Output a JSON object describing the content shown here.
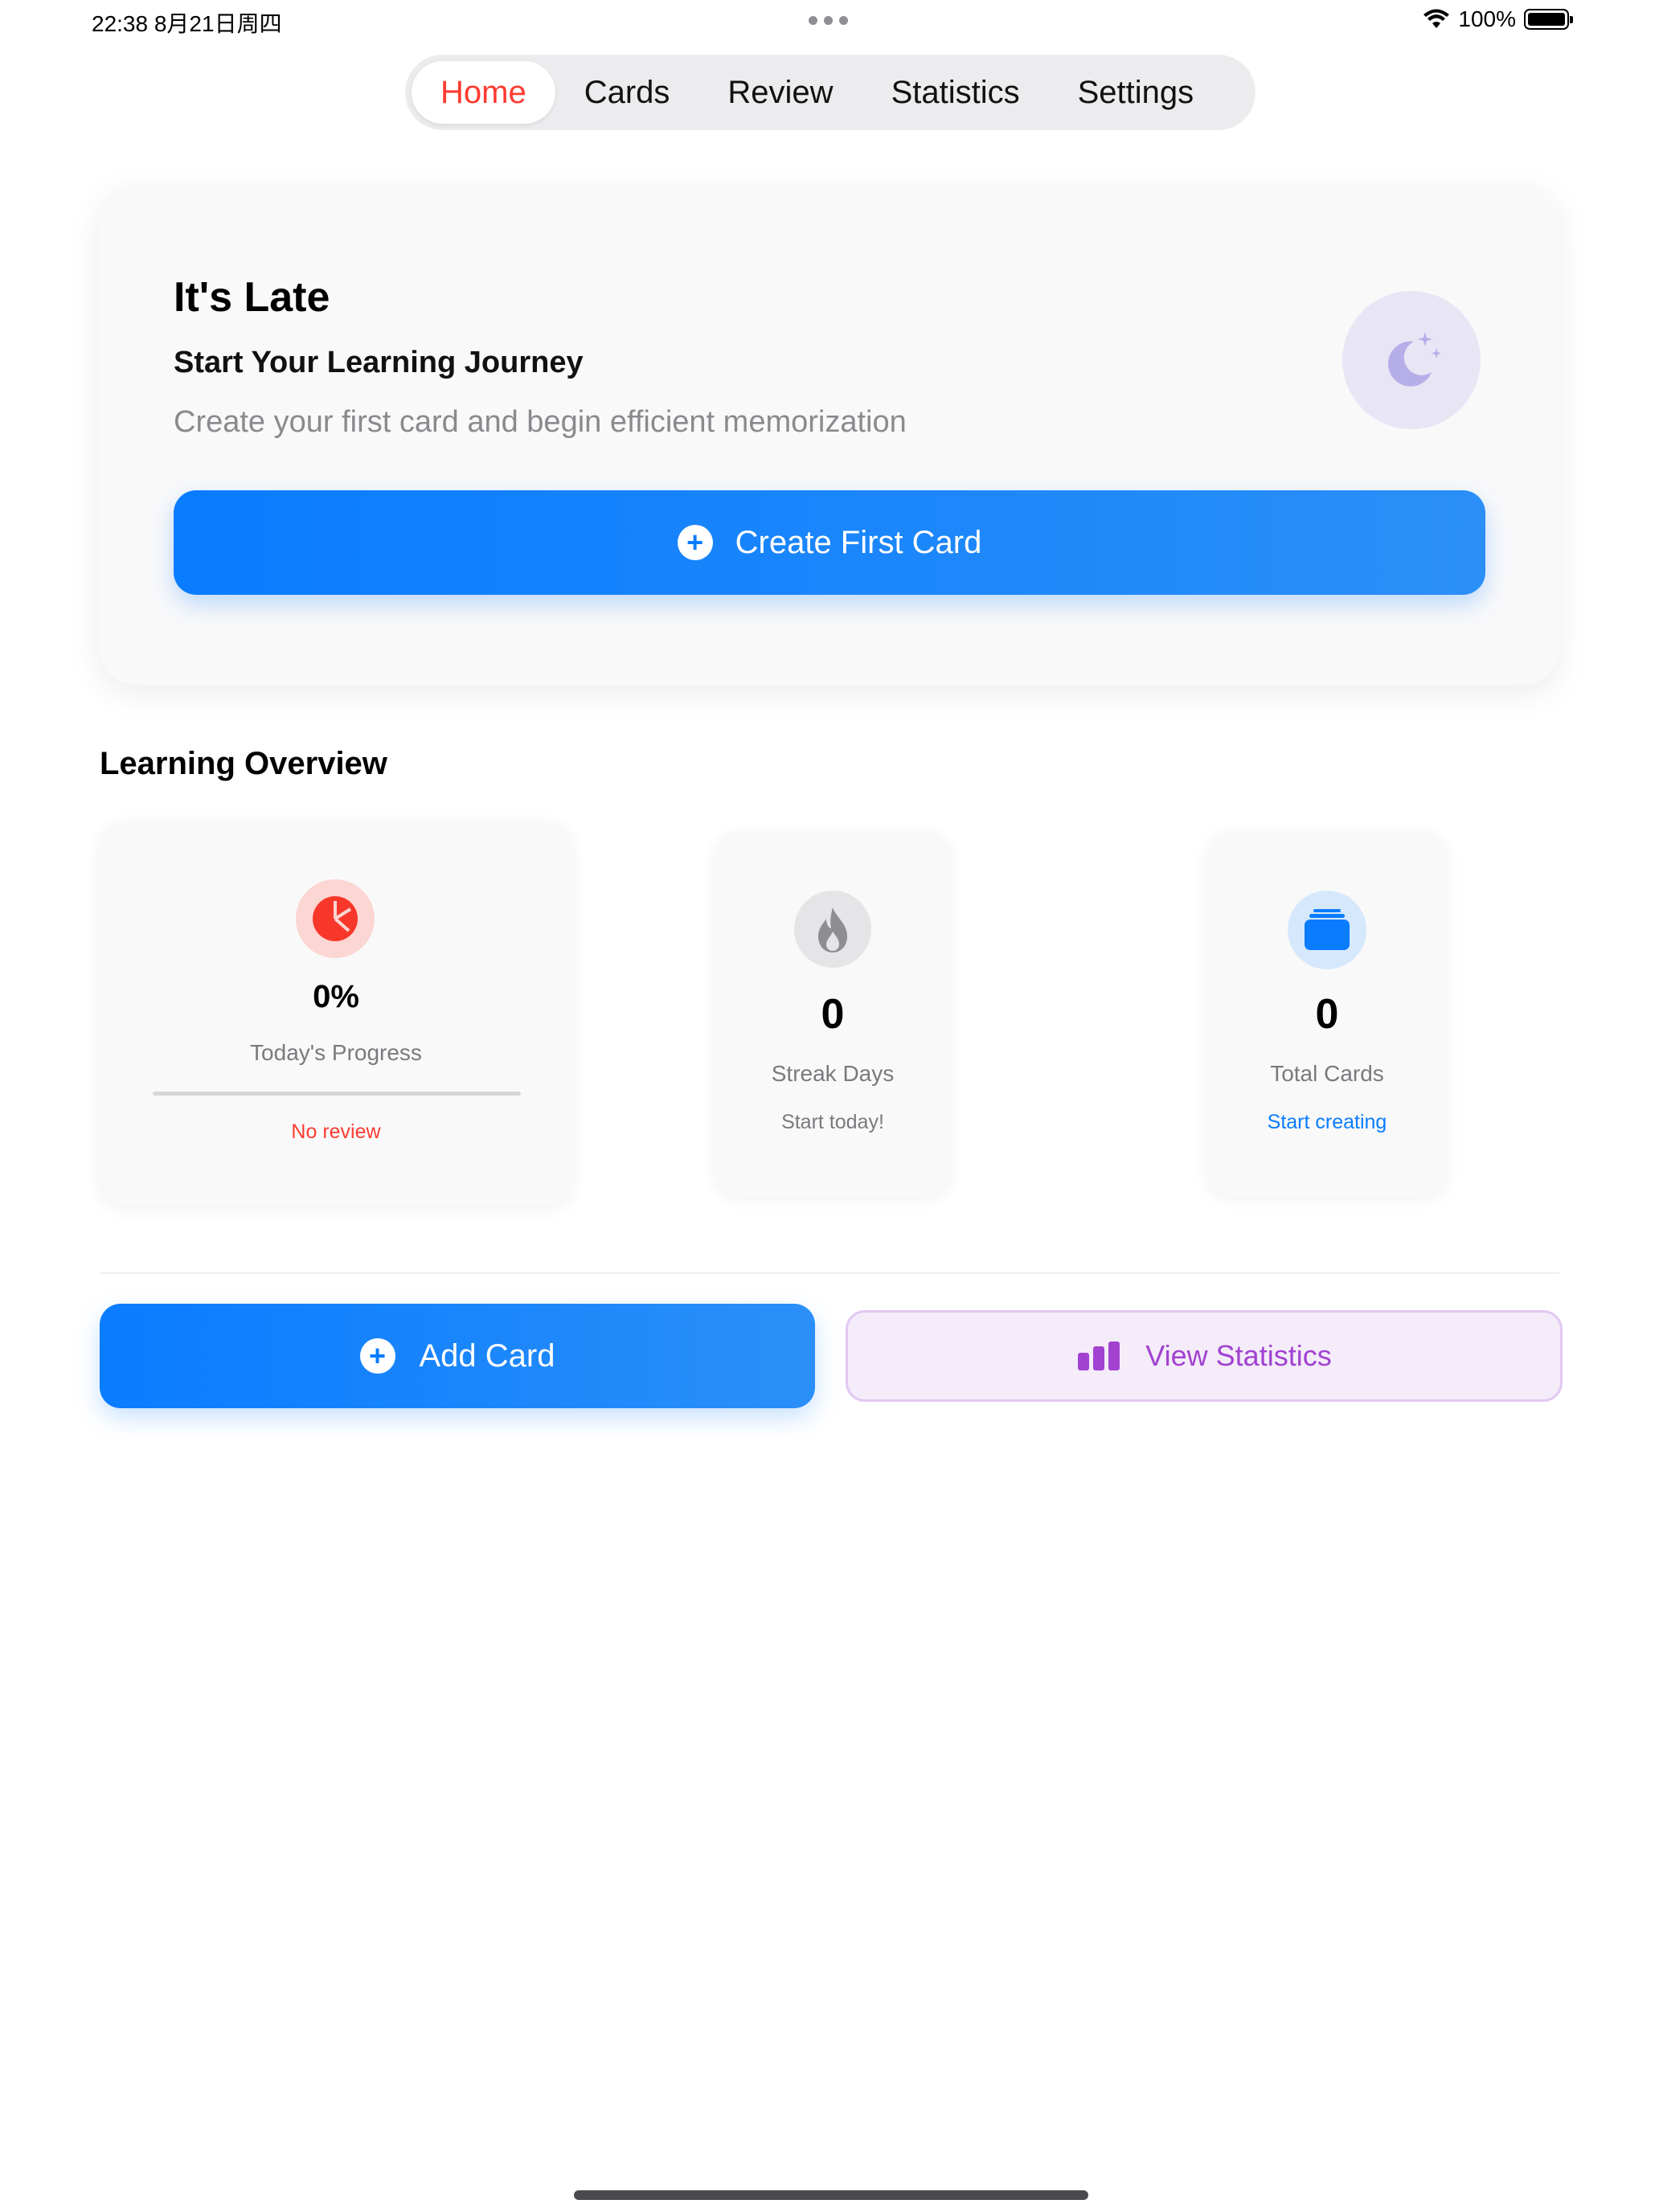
{
  "status_bar": {
    "time_date": "22:38  8月21日周四",
    "battery_percent": "100%",
    "battery_level": 1.0
  },
  "tabs": [
    {
      "label": "Home",
      "active": true
    },
    {
      "label": "Cards",
      "active": false
    },
    {
      "label": "Review",
      "active": false
    },
    {
      "label": "Statistics",
      "active": false
    },
    {
      "label": "Settings",
      "active": false
    }
  ],
  "hero": {
    "title": "It's Late",
    "subtitle": "Start Your Learning Journey",
    "description": "Create your first card and begin efficient memorization",
    "icon": "moon-stars-icon",
    "cta_label": "Create First Card"
  },
  "overview": {
    "title": "Learning Overview",
    "progress": {
      "icon": "pie-chart-icon",
      "value": "0%",
      "label": "Today's Progress",
      "note": "No review",
      "level": 0
    },
    "streak": {
      "icon": "flame-icon",
      "value": "0",
      "label": "Streak Days",
      "note": "Start today!"
    },
    "total": {
      "icon": "stack-cards-icon",
      "value": "0",
      "label": "Total Cards",
      "note": "Start creating"
    }
  },
  "actions": {
    "add_card_label": "Add Card",
    "view_stats_label": "View Statistics"
  },
  "colors": {
    "accent_blue": "#0a7cff",
    "active_tab_red": "#ff3b30",
    "purple": "#a142d1"
  }
}
